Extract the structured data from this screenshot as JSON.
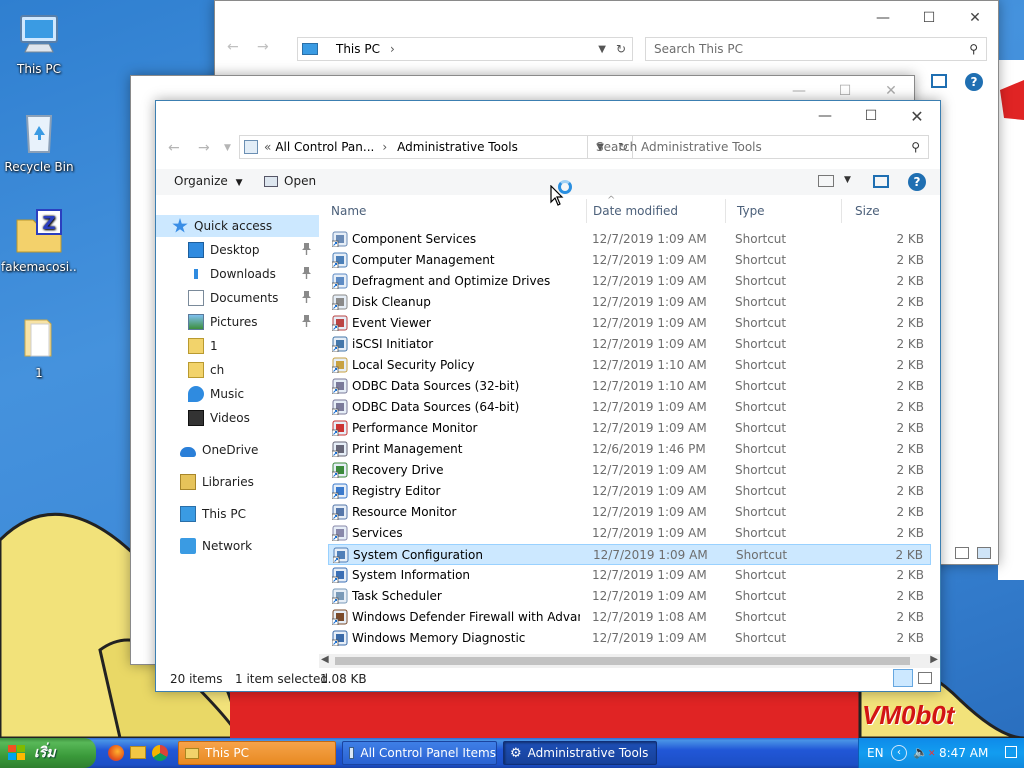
{
  "desktop": {
    "icons": [
      {
        "label": "This PC"
      },
      {
        "label": "Recycle Bin"
      },
      {
        "label": "fakemacosi..."
      },
      {
        "label": "1"
      }
    ],
    "watermark": "VM0b0t"
  },
  "back_window": {
    "address": "This PC",
    "search_placeholder": "Search This PC"
  },
  "main_window": {
    "address": {
      "crumb1": "All Control Pan...",
      "crumb2": "Administrative Tools"
    },
    "search_placeholder": "Search Administrative Tools",
    "commands": {
      "organize": "Organize",
      "open": "Open"
    },
    "nav": [
      {
        "label": "Quick access",
        "icon": "star-icon"
      },
      {
        "label": "Desktop",
        "icon": "desktop-icon",
        "pinned": true
      },
      {
        "label": "Downloads",
        "icon": "download-icon",
        "pinned": true
      },
      {
        "label": "Documents",
        "icon": "documents-icon",
        "pinned": true
      },
      {
        "label": "Pictures",
        "icon": "pictures-icon",
        "pinned": true
      },
      {
        "label": "1",
        "icon": "folder-icon"
      },
      {
        "label": "ch",
        "icon": "folder-icon"
      },
      {
        "label": "Music",
        "icon": "music-icon"
      },
      {
        "label": "Videos",
        "icon": "videos-icon"
      },
      {
        "label": "OneDrive",
        "icon": "cloud-icon"
      },
      {
        "label": "Libraries",
        "icon": "libraries-icon"
      },
      {
        "label": "This PC",
        "icon": "computer-icon"
      },
      {
        "label": "Network",
        "icon": "network-icon"
      }
    ],
    "columns": {
      "name": "Name",
      "date": "Date modified",
      "type": "Type",
      "size": "Size"
    },
    "files": [
      {
        "name": "Component Services",
        "date": "12/7/2019 1:09 AM",
        "type": "Shortcut",
        "size": "2 KB"
      },
      {
        "name": "Computer Management",
        "date": "12/7/2019 1:09 AM",
        "type": "Shortcut",
        "size": "2 KB"
      },
      {
        "name": "Defragment and Optimize Drives",
        "date": "12/7/2019 1:09 AM",
        "type": "Shortcut",
        "size": "2 KB"
      },
      {
        "name": "Disk Cleanup",
        "date": "12/7/2019 1:09 AM",
        "type": "Shortcut",
        "size": "2 KB"
      },
      {
        "name": "Event Viewer",
        "date": "12/7/2019 1:09 AM",
        "type": "Shortcut",
        "size": "2 KB"
      },
      {
        "name": "iSCSI Initiator",
        "date": "12/7/2019 1:09 AM",
        "type": "Shortcut",
        "size": "2 KB"
      },
      {
        "name": "Local Security Policy",
        "date": "12/7/2019 1:10 AM",
        "type": "Shortcut",
        "size": "2 KB"
      },
      {
        "name": "ODBC Data Sources (32-bit)",
        "date": "12/7/2019 1:10 AM",
        "type": "Shortcut",
        "size": "2 KB"
      },
      {
        "name": "ODBC Data Sources (64-bit)",
        "date": "12/7/2019 1:09 AM",
        "type": "Shortcut",
        "size": "2 KB"
      },
      {
        "name": "Performance Monitor",
        "date": "12/7/2019 1:09 AM",
        "type": "Shortcut",
        "size": "2 KB"
      },
      {
        "name": "Print Management",
        "date": "12/6/2019 1:46 PM",
        "type": "Shortcut",
        "size": "2 KB"
      },
      {
        "name": "Recovery Drive",
        "date": "12/7/2019 1:09 AM",
        "type": "Shortcut",
        "size": "2 KB"
      },
      {
        "name": "Registry Editor",
        "date": "12/7/2019 1:09 AM",
        "type": "Shortcut",
        "size": "2 KB"
      },
      {
        "name": "Resource Monitor",
        "date": "12/7/2019 1:09 AM",
        "type": "Shortcut",
        "size": "2 KB"
      },
      {
        "name": "Services",
        "date": "12/7/2019 1:09 AM",
        "type": "Shortcut",
        "size": "2 KB"
      },
      {
        "name": "System Configuration",
        "date": "12/7/2019 1:09 AM",
        "type": "Shortcut",
        "size": "2 KB",
        "selected": true
      },
      {
        "name": "System Information",
        "date": "12/7/2019 1:09 AM",
        "type": "Shortcut",
        "size": "2 KB"
      },
      {
        "name": "Task Scheduler",
        "date": "12/7/2019 1:09 AM",
        "type": "Shortcut",
        "size": "2 KB"
      },
      {
        "name": "Windows Defender Firewall with Advanc...",
        "date": "12/7/2019 1:08 AM",
        "type": "Shortcut",
        "size": "2 KB"
      },
      {
        "name": "Windows Memory Diagnostic",
        "date": "12/7/2019 1:09 AM",
        "type": "Shortcut",
        "size": "2 KB"
      }
    ],
    "status": {
      "count": "20 items",
      "selected": "1 item selected",
      "size": "1.08 KB"
    }
  },
  "taskbar": {
    "start_label": "เริ่ม",
    "buttons": [
      {
        "label": "This PC"
      },
      {
        "label": "All Control Panel Items"
      },
      {
        "label": "Administrative Tools"
      }
    ],
    "language": "EN",
    "clock": "8:47 AM"
  },
  "colors": {
    "selection": "#cce8ff",
    "accent": "#0078d7",
    "taskbar": "#1c4fc6",
    "start": "#3a9a3a"
  }
}
